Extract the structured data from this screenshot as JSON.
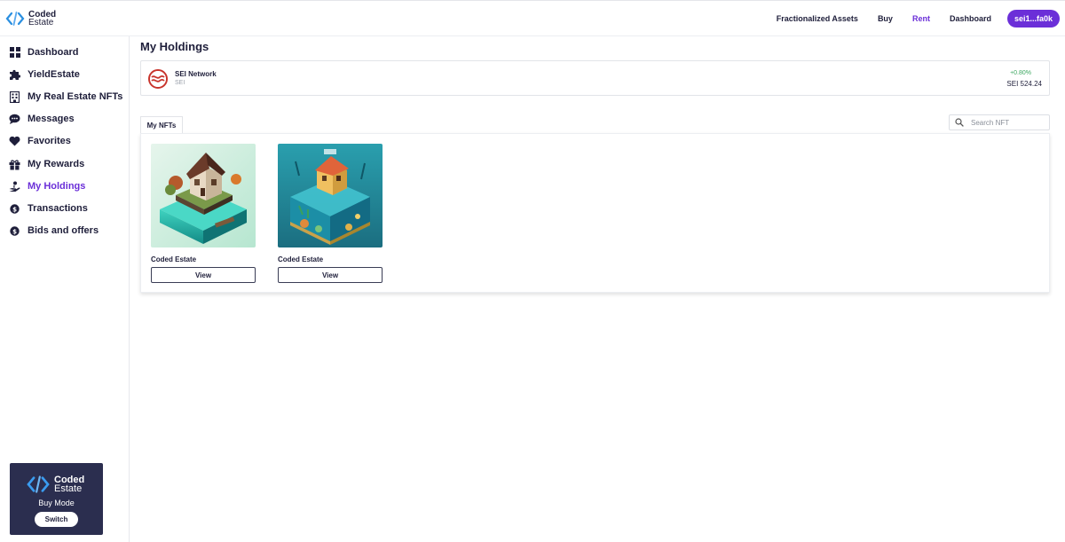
{
  "header": {
    "logo_line1": "Coded",
    "logo_line2": "Estate",
    "nav": [
      {
        "label": "Fractionalized Assets",
        "active": false
      },
      {
        "label": "Buy",
        "active": false
      },
      {
        "label": "Rent",
        "active": true
      },
      {
        "label": "Dashboard",
        "active": false
      }
    ],
    "wallet": "sei1...fa0k"
  },
  "sidebar": {
    "items": [
      {
        "label": "Dashboard",
        "icon": "grid-icon"
      },
      {
        "label": "YieldEstate",
        "icon": "puzzle-icon"
      },
      {
        "label": "My Real Estate NFTs",
        "icon": "building-icon"
      },
      {
        "label": "Messages",
        "icon": "chat-icon"
      },
      {
        "label": "Favorites",
        "icon": "heart-icon"
      },
      {
        "label": "My Rewards",
        "icon": "gift-icon"
      },
      {
        "label": "My Holdings",
        "icon": "hand-holding-icon",
        "active": true
      },
      {
        "label": "Transactions",
        "icon": "coin-icon"
      },
      {
        "label": "Bids and offers",
        "icon": "coin-icon"
      }
    ],
    "mode_card": {
      "logo_line1": "Coded",
      "logo_line2": "Estate",
      "mode": "Buy Mode",
      "switch_label": "Switch"
    }
  },
  "main": {
    "title": "My Holdings",
    "token": {
      "name": "SEI Network",
      "symbol": "SEI",
      "change": "+0.80%",
      "price": "SEI 524.24"
    },
    "tab": "My NFTs",
    "search_placeholder": "Search NFT",
    "nfts": [
      {
        "title": "Coded Estate",
        "button": "View"
      },
      {
        "title": "Coded Estate",
        "button": "View"
      }
    ]
  },
  "colors": {
    "accent": "#6b2fd8",
    "dark_card": "#2b2e4f",
    "positive": "#3ea862"
  }
}
